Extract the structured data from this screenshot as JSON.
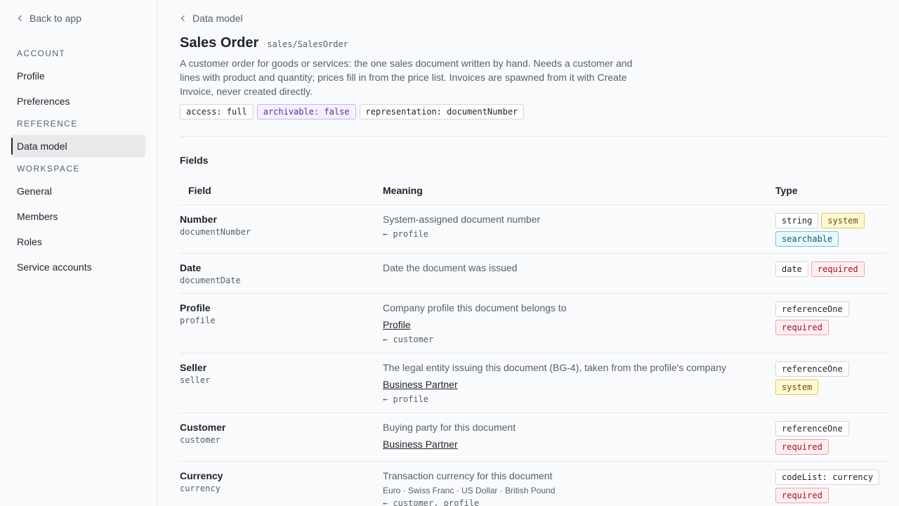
{
  "sidebar": {
    "back_label": "Back to app",
    "sections": {
      "account": "ACCOUNT",
      "reference": "REFERENCE",
      "workspace": "WORKSPACE"
    },
    "items": {
      "profile": "Profile",
      "preferences": "Preferences",
      "data_model": "Data model",
      "general": "General",
      "members": "Members",
      "roles": "Roles",
      "service_accounts": "Service accounts"
    },
    "active_item": "Data model"
  },
  "main": {
    "breadcrumb": "Data model",
    "title": "Sales Order",
    "path": "sales/SalesOrder",
    "description": "A customer order for goods or services: the one sales document written by hand. Needs a customer and lines with product and quantity; prices fill in from the price list. Invoices are spawned from it with Create Invoice, never created directly.",
    "tags": [
      "access: full",
      "archivable: false",
      "representation: documentNumber"
    ],
    "fields_heading": "Fields",
    "columns": {
      "field": "Field",
      "meaning": "Meaning",
      "type": "Type"
    },
    "rows": [
      {
        "name": "Number",
        "key": "documentNumber",
        "meaning": "System-assigned document number",
        "sub": "← profile",
        "types": [
          "string",
          "system",
          "searchable"
        ]
      },
      {
        "name": "Date",
        "key": "documentDate",
        "meaning": "Date the document was issued",
        "types": [
          "date",
          "required"
        ]
      },
      {
        "name": "Profile",
        "key": "profile",
        "meaning": "Company profile this document belongs to",
        "link": "Profile",
        "sub": "← customer",
        "types": [
          "referenceOne",
          "required"
        ]
      },
      {
        "name": "Seller",
        "key": "seller",
        "meaning": "The legal entity issuing this document (BG-4), taken from the profile's company",
        "link": "Business Partner",
        "sub": "← profile",
        "types": [
          "referenceOne",
          "system"
        ]
      },
      {
        "name": "Customer",
        "key": "customer",
        "meaning": "Buying party for this document",
        "link": "Business Partner",
        "types": [
          "referenceOne",
          "required"
        ]
      },
      {
        "name": "Currency",
        "key": "currency",
        "meaning": "Transaction currency for this document",
        "options": "Euro · Swiss Franc · US Dollar · British Pound",
        "sub": "← customer, profile",
        "types": [
          "codeList: currency",
          "required"
        ]
      }
    ]
  },
  "colors": {
    "system": "#fff8d6",
    "searchable": "#e9f8fc",
    "required": "#ffeef0",
    "archivable": "#f5f0ff"
  }
}
